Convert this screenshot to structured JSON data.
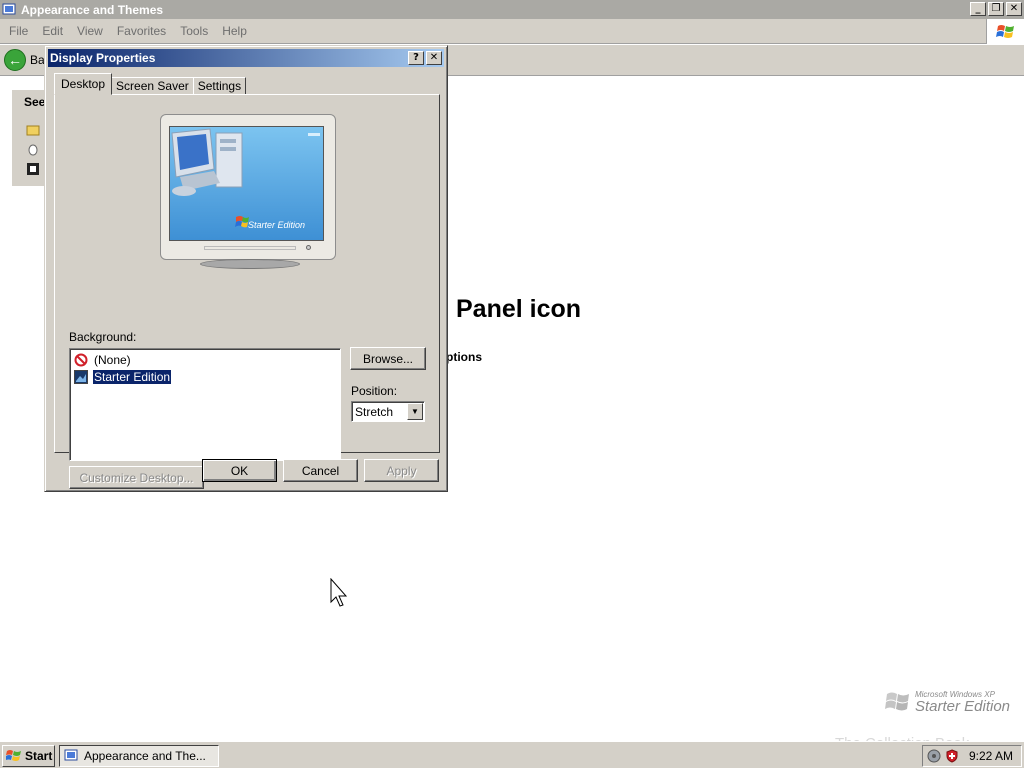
{
  "explorer": {
    "title": "Appearance and Themes",
    "menu": [
      "File",
      "Edit",
      "View",
      "Favorites",
      "Tools",
      "Help"
    ],
    "back_label": "Ba",
    "taskpane_heading": "See",
    "heading_partial": "Panel icon",
    "options_partial": "ptions"
  },
  "dialog": {
    "title": "Display Properties",
    "help_glyph": "?",
    "close_glyph": "✕",
    "tabs": [
      {
        "label": "Desktop",
        "active": true
      },
      {
        "label": "Screen Saver",
        "active": false
      },
      {
        "label": "Settings",
        "active": false
      }
    ],
    "preview_brand": "Starter Edition",
    "background_label": "Background:",
    "backgrounds": [
      {
        "label": "(None)",
        "selected": false,
        "icon": "no-entry-icon"
      },
      {
        "label": "Starter Edition",
        "selected": true,
        "icon": "image-file-icon"
      }
    ],
    "browse_label": "Browse...",
    "position_label": "Position:",
    "position_value": "Stretch",
    "customize_label": "Customize Desktop...",
    "ok_label": "OK",
    "cancel_label": "Cancel",
    "apply_label": "Apply"
  },
  "watermark": {
    "small": "Microsoft Windows XP",
    "big": "Starter Edition",
    "collection": "The Collection Book"
  },
  "taskbar": {
    "start_label": "Start",
    "task_label": "Appearance and The...",
    "clock": "9:22 AM"
  },
  "colors": {
    "title_active": "#0a246a",
    "title_inactive": "#aaa9a4",
    "face": "#d4d0c8",
    "selection": "#0a246a",
    "preview_sky": "#5aaee6"
  }
}
